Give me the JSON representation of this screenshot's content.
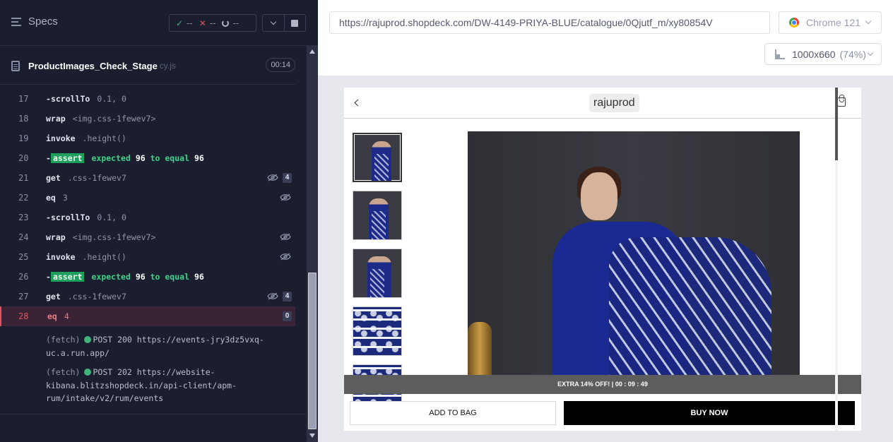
{
  "reporter": {
    "specs_label": "Specs",
    "stats": {
      "passed": "--",
      "failed": "--",
      "pending": "--"
    },
    "spec": {
      "name": "ProductImages_Check_Stage",
      "ext": "cy.js",
      "duration": "00:14"
    },
    "commands": [
      {
        "num": "17",
        "dash": "-",
        "name": "scrollTo",
        "msg": "0.1, 0"
      },
      {
        "num": "18",
        "name": "wrap",
        "msg": "<img.css-1fewev7>"
      },
      {
        "num": "19",
        "name": "invoke",
        "msg": ".height()"
      },
      {
        "num": "20",
        "dash": "-",
        "assert": "assert",
        "expected": "expected",
        "v1": "96",
        "to_equal": "to equal",
        "v2": "96"
      },
      {
        "num": "21",
        "name": "get",
        "msg": ".css-1fewev7",
        "count": "4"
      },
      {
        "num": "22",
        "name": "eq",
        "msg": "3"
      },
      {
        "num": "23",
        "dash": "-",
        "name": "scrollTo",
        "msg": "0.1, 0"
      },
      {
        "num": "24",
        "name": "wrap",
        "msg": "<img.css-1fewev7>"
      },
      {
        "num": "25",
        "name": "invoke",
        "msg": ".height()"
      },
      {
        "num": "26",
        "dash": "-",
        "assert": "assert",
        "expected": "expected",
        "v1": "96",
        "to_equal": "to equal",
        "v2": "96"
      },
      {
        "num": "27",
        "name": "get",
        "msg": ".css-1fewev7",
        "count": "4"
      },
      {
        "num": "28",
        "name": "eq",
        "msg": "4",
        "count": "0"
      }
    ],
    "fetches": [
      {
        "tag": "(fetch)",
        "text": "POST 200 https://events-jry3dz5vxq-uc.a.run.app/"
      },
      {
        "tag": "(fetch)",
        "text": "POST 202 https://website-kibana.blitzshopdeck.in/api-client/apm-rum/intake/v2/rum/events"
      }
    ]
  },
  "aut": {
    "url": "https://rajuprod.shopdeck.com/DW-4149-PRIYA-BLUE/catalogue/0Qjutf_m/xy80854V",
    "browser": "Chrome 121",
    "viewport": "1000x660",
    "viewport_pct": "(74%)",
    "app": {
      "brand": "rajuprod",
      "offer": "EXTRA 14% OFF! | 00 : 09 : 49",
      "add_to_bag": "ADD TO BAG",
      "buy_now": "BUY NOW"
    }
  }
}
